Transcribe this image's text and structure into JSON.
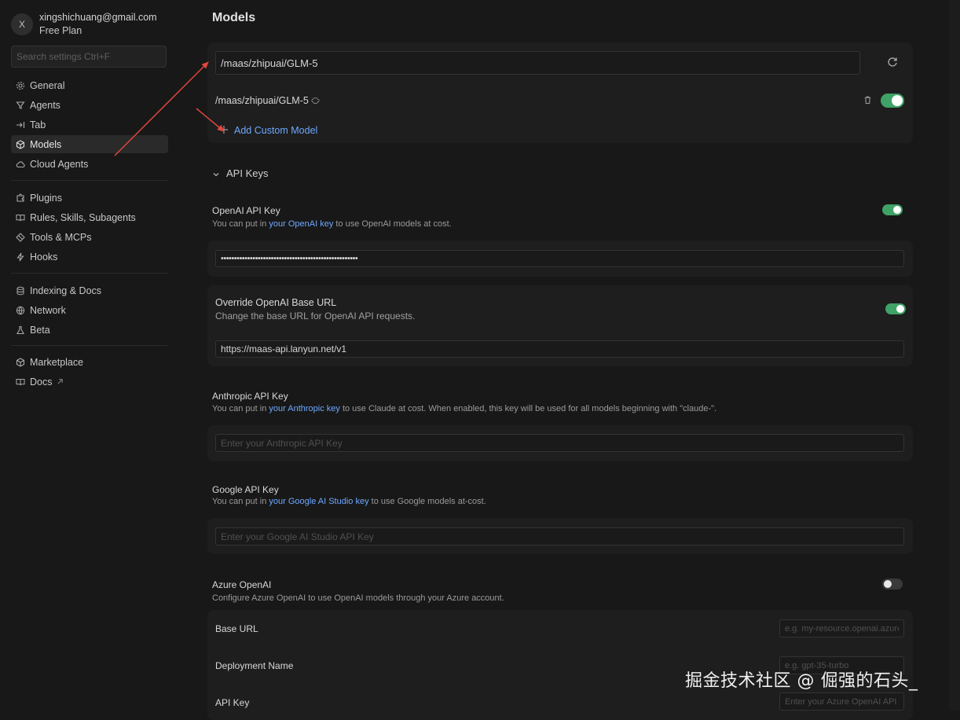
{
  "account": {
    "avatar_letter": "X",
    "email": "xingshichuang@gmail.com",
    "plan": "Free Plan"
  },
  "search": {
    "placeholder": "Search settings Ctrl+F"
  },
  "nav": {
    "group1": [
      "General",
      "Agents",
      "Tab",
      "Models",
      "Cloud Agents"
    ],
    "group2": [
      "Plugins",
      "Rules, Skills, Subagents",
      "Tools & MCPs",
      "Hooks"
    ],
    "group3": [
      "Indexing & Docs",
      "Network",
      "Beta"
    ],
    "group4": [
      "Marketplace",
      "Docs"
    ],
    "active": "Models",
    "icons": {
      "General": "gear-icon",
      "Agents": "filter-icon",
      "Tab": "tab-arrow-icon",
      "Models": "cube-icon",
      "Cloud Agents": "cloud-icon",
      "Plugins": "puzzle-icon",
      "Rules, Skills, Subagents": "book-icon",
      "Tools & MCPs": "diamond-icon",
      "Hooks": "lightning-icon",
      "Indexing & Docs": "database-icon",
      "Network": "globe-icon",
      "Beta": "flask-icon",
      "Marketplace": "package-icon",
      "Docs": "book-icon"
    }
  },
  "models": {
    "title": "Models",
    "input_value": "/maas/zhipuai/GLM-5",
    "model_name": "/maas/zhipuai/GLM-5",
    "model_enabled": true,
    "add_custom_label": "Add Custom Model"
  },
  "api_keys": {
    "section_label": "API Keys",
    "openai": {
      "label": "OpenAI API Key",
      "desc_prefix": "You can put in ",
      "desc_link": "your OpenAI key",
      "desc_suffix": " to use OpenAI models at cost.",
      "enabled": true,
      "value": "••••••••••••••••••••••••••••••••••••••••••••••••••••"
    },
    "override": {
      "label": "Override OpenAI Base URL",
      "desc": "Change the base URL for OpenAI API requests.",
      "enabled": true,
      "value": "https://maas-api.lanyun.net/v1"
    },
    "anthropic": {
      "label": "Anthropic API Key",
      "desc_prefix": "You can put in ",
      "desc_link": "your Anthropic key",
      "desc_suffix": " to use Claude at cost. When enabled, this key will be used for all models beginning with \"claude-\".",
      "placeholder": "Enter your Anthropic API Key"
    },
    "google": {
      "label": "Google API Key",
      "desc_prefix": "You can put in ",
      "desc_link": "your Google AI Studio key",
      "desc_suffix": " to use Google models at-cost.",
      "placeholder": "Enter your Google AI Studio API Key"
    },
    "azure": {
      "label": "Azure OpenAI",
      "desc": "Configure Azure OpenAI to use OpenAI models through your Azure account.",
      "enabled": false,
      "base_url_label": "Base URL",
      "base_url_placeholder": "e.g. my-resource.openai.azure.com",
      "deployment_label": "Deployment Name",
      "deployment_placeholder": "e.g. gpt-35-turbo",
      "api_key_label": "API Key",
      "api_key_placeholder": "Enter your Azure OpenAI API Key"
    }
  },
  "watermark": "掘金技术社区 @ 倔强的石头_",
  "colors": {
    "accent_link": "#6ea8ff",
    "toggle_on": "#3fa266",
    "annotation_arrow": "#e0473e"
  }
}
